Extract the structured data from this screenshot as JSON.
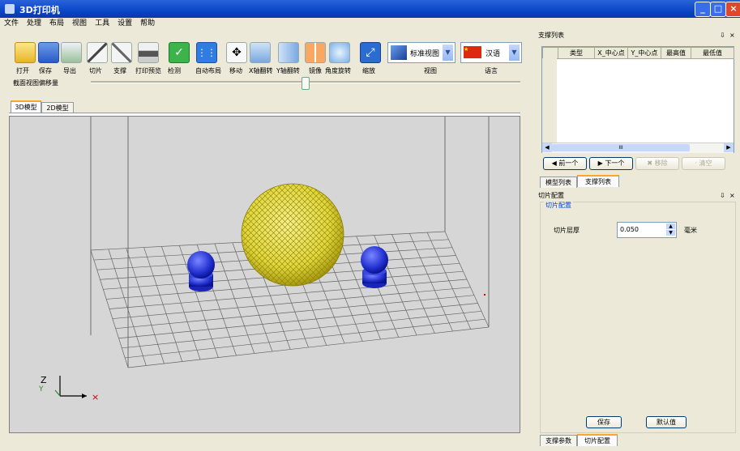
{
  "window": {
    "title": "3D打印机"
  },
  "menu": [
    "文件",
    "处理",
    "布局",
    "视图",
    "工具",
    "设置",
    "帮助"
  ],
  "toolbar": {
    "open": "打开",
    "save": "保存",
    "export": "导出",
    "slice": "切片",
    "support": "支撑",
    "print_preview": "打印预览",
    "check": "检测",
    "auto_layout": "自动布局",
    "move": "移动",
    "x_rotate": "X轴翻转",
    "y_rotate": "Y轴翻转",
    "mirror": "镜像",
    "angle_rotate": "角度旋转",
    "scale": "缩放",
    "view_select": "标准视图",
    "view_label": "视图",
    "lang_select": "汉语",
    "lang_label": "语言",
    "slider_label": "截面视图偏移量"
  },
  "view_tabs": [
    "3D模型",
    "2D模型"
  ],
  "support_panel": {
    "title": "支撑列表",
    "columns": [
      "类型",
      "X_中心点",
      "Y_中心点",
      "最高值",
      "最低值"
    ],
    "scroll_mid": "III",
    "prev": "前一个",
    "next": "下一个",
    "remove": "移除",
    "clear": "清空"
  },
  "panel_tabs": [
    "模型列表",
    "支撑列表"
  ],
  "slice_panel": {
    "title": "切片配置",
    "group": "切片配置",
    "layer_label": "切片层厚",
    "layer_value": "0.050",
    "unit": "毫米",
    "save": "保存",
    "default": "默认值"
  },
  "bottom_tabs": [
    "支撑参数",
    "切片配置"
  ],
  "axis": {
    "z": "Z",
    "y": "Y"
  }
}
